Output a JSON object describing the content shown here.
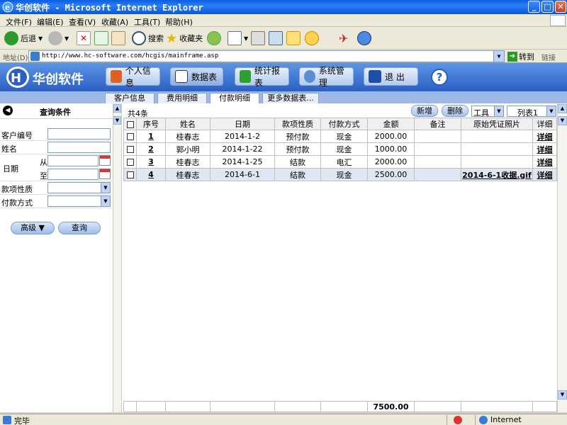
{
  "window": {
    "title": "华创软件 - Microsoft Internet Explorer"
  },
  "menu": [
    "文件(F)",
    "编辑(E)",
    "查看(V)",
    "收藏(A)",
    "工具(T)",
    "帮助(H)"
  ],
  "toolbar": {
    "back": "后退",
    "search": "搜索",
    "favorites": "收藏夹"
  },
  "address": {
    "label": "地址(D)",
    "url": "http://www.hc-software.com/hcgis/mainframe.asp",
    "go": "转到",
    "links": "链接"
  },
  "app": {
    "brand": "华创软件",
    "nav": [
      "个人信息",
      "数据表",
      "统计报表",
      "系统管理",
      "退 出"
    ],
    "help": "?"
  },
  "tabs": [
    "客户信息",
    "费用明细",
    "付款明细",
    "更多数据表..."
  ],
  "filter": {
    "title": "查询条件",
    "customer_no": "客户编号",
    "name": "姓名",
    "date": "日期",
    "from": "从",
    "to": "至",
    "payment_nature": "款项性质",
    "payment_method": "付款方式",
    "advanced": "高级 ▼",
    "query": "查询"
  },
  "grid": {
    "count": "共4条",
    "new_btn": "新增",
    "delete_btn": "删除",
    "tools": "工具",
    "list": "列表1",
    "headers": [
      "序号",
      "姓名",
      "日期",
      "款项性质",
      "付款方式",
      "金额",
      "备注",
      "原始凭证照片",
      "详细"
    ],
    "rows": [
      {
        "no": "1",
        "name": "桂春志",
        "date": "2014-1-2",
        "nature": "预付款",
        "method": "现金",
        "amount": "2000.00",
        "note": "",
        "photo": "",
        "detail": "详细"
      },
      {
        "no": "2",
        "name": "郭小明",
        "date": "2014-1-22",
        "nature": "预付款",
        "method": "现金",
        "amount": "1000.00",
        "note": "",
        "photo": "",
        "detail": "详细"
      },
      {
        "no": "3",
        "name": "桂春志",
        "date": "2014-1-25",
        "nature": "结款",
        "method": "电汇",
        "amount": "2000.00",
        "note": "",
        "photo": "",
        "detail": "详细"
      },
      {
        "no": "4",
        "name": "桂春志",
        "date": "2014-6-1",
        "nature": "结款",
        "method": "现金",
        "amount": "2500.00",
        "note": "",
        "photo": "2014-6-1收据.gif",
        "detail": "详细"
      }
    ],
    "total": "7500.00"
  },
  "status": {
    "text": "完毕",
    "zone": "Internet"
  }
}
